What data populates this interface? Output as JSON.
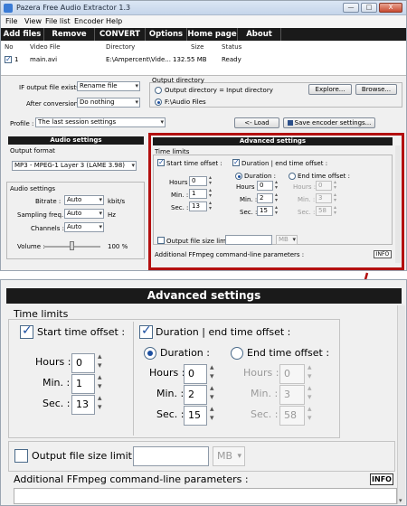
{
  "window": {
    "title": "Pazera Free Audio Extractor 1.3",
    "buttons": [
      "—",
      "□",
      "X"
    ]
  },
  "menu": [
    "File",
    "View",
    "File list",
    "Encoder",
    "Help"
  ],
  "toolbar": [
    "Add files",
    "Remove",
    "CONVERT",
    "Options",
    "Home page",
    "About"
  ],
  "filelist": {
    "columns": [
      "No",
      "Video File",
      "Directory",
      "Size",
      "Status"
    ],
    "rows": [
      {
        "no": "1",
        "file": "main.avi",
        "dir": "E:\\Ampercent\\Vide...",
        "size": "132.55 MB",
        "status": "Ready"
      }
    ]
  },
  "output": {
    "if_exists_label": "IF output file exists :",
    "if_exists_value": "Rename file",
    "after_label": "After conversion :",
    "after_value": "Do nothing",
    "dir_title": "Output directory",
    "opt1": "Output directory = Input directory",
    "dir_value": "F:\\Audio Files",
    "explore": "Explore...",
    "browse": "Browse..."
  },
  "profile": {
    "label": "Profile :",
    "value": "The last session settings",
    "load": "<- Load",
    "save": "Save encoder settings..."
  },
  "audio": {
    "title": "Audio settings",
    "format_label": "Output format",
    "format_value": "MP3 - MPEG-1 Layer 3 (LAME 3.98)",
    "settings_label": "Audio settings",
    "bitrate_label": "Bitrate :",
    "bitrate_value": "Auto",
    "bitrate_unit": "kbit/s",
    "freq_label": "Sampling freq. :",
    "freq_value": "Auto",
    "freq_unit": "Hz",
    "channels_label": "Channels :",
    "channels_value": "Auto",
    "volume_label": "Volume :",
    "volume_value": "100 %"
  },
  "advanced": {
    "title": "Advanced settings",
    "time_limits": "Time limits",
    "start_label": "Start time offset :",
    "duration_end_label": "Duration | end time offset :",
    "duration_label": "Duration :",
    "end_label": "End time offset :",
    "hours": "Hours :",
    "min": "Min. :",
    "sec": "Sec. :",
    "start_h": "0",
    "start_m": "1",
    "start_s": "13",
    "dur_h": "0",
    "dur_m": "2",
    "dur_s": "15",
    "end_h": "0",
    "end_m": "3",
    "end_s": "58",
    "size_limit": "Output file size limit :",
    "size_unit": "MB",
    "params": "Additional FFmpeg command-line parameters :",
    "info": "INFO"
  },
  "colors": {
    "toolbar": "#1a1a1a",
    "highlight": "#b31010"
  }
}
